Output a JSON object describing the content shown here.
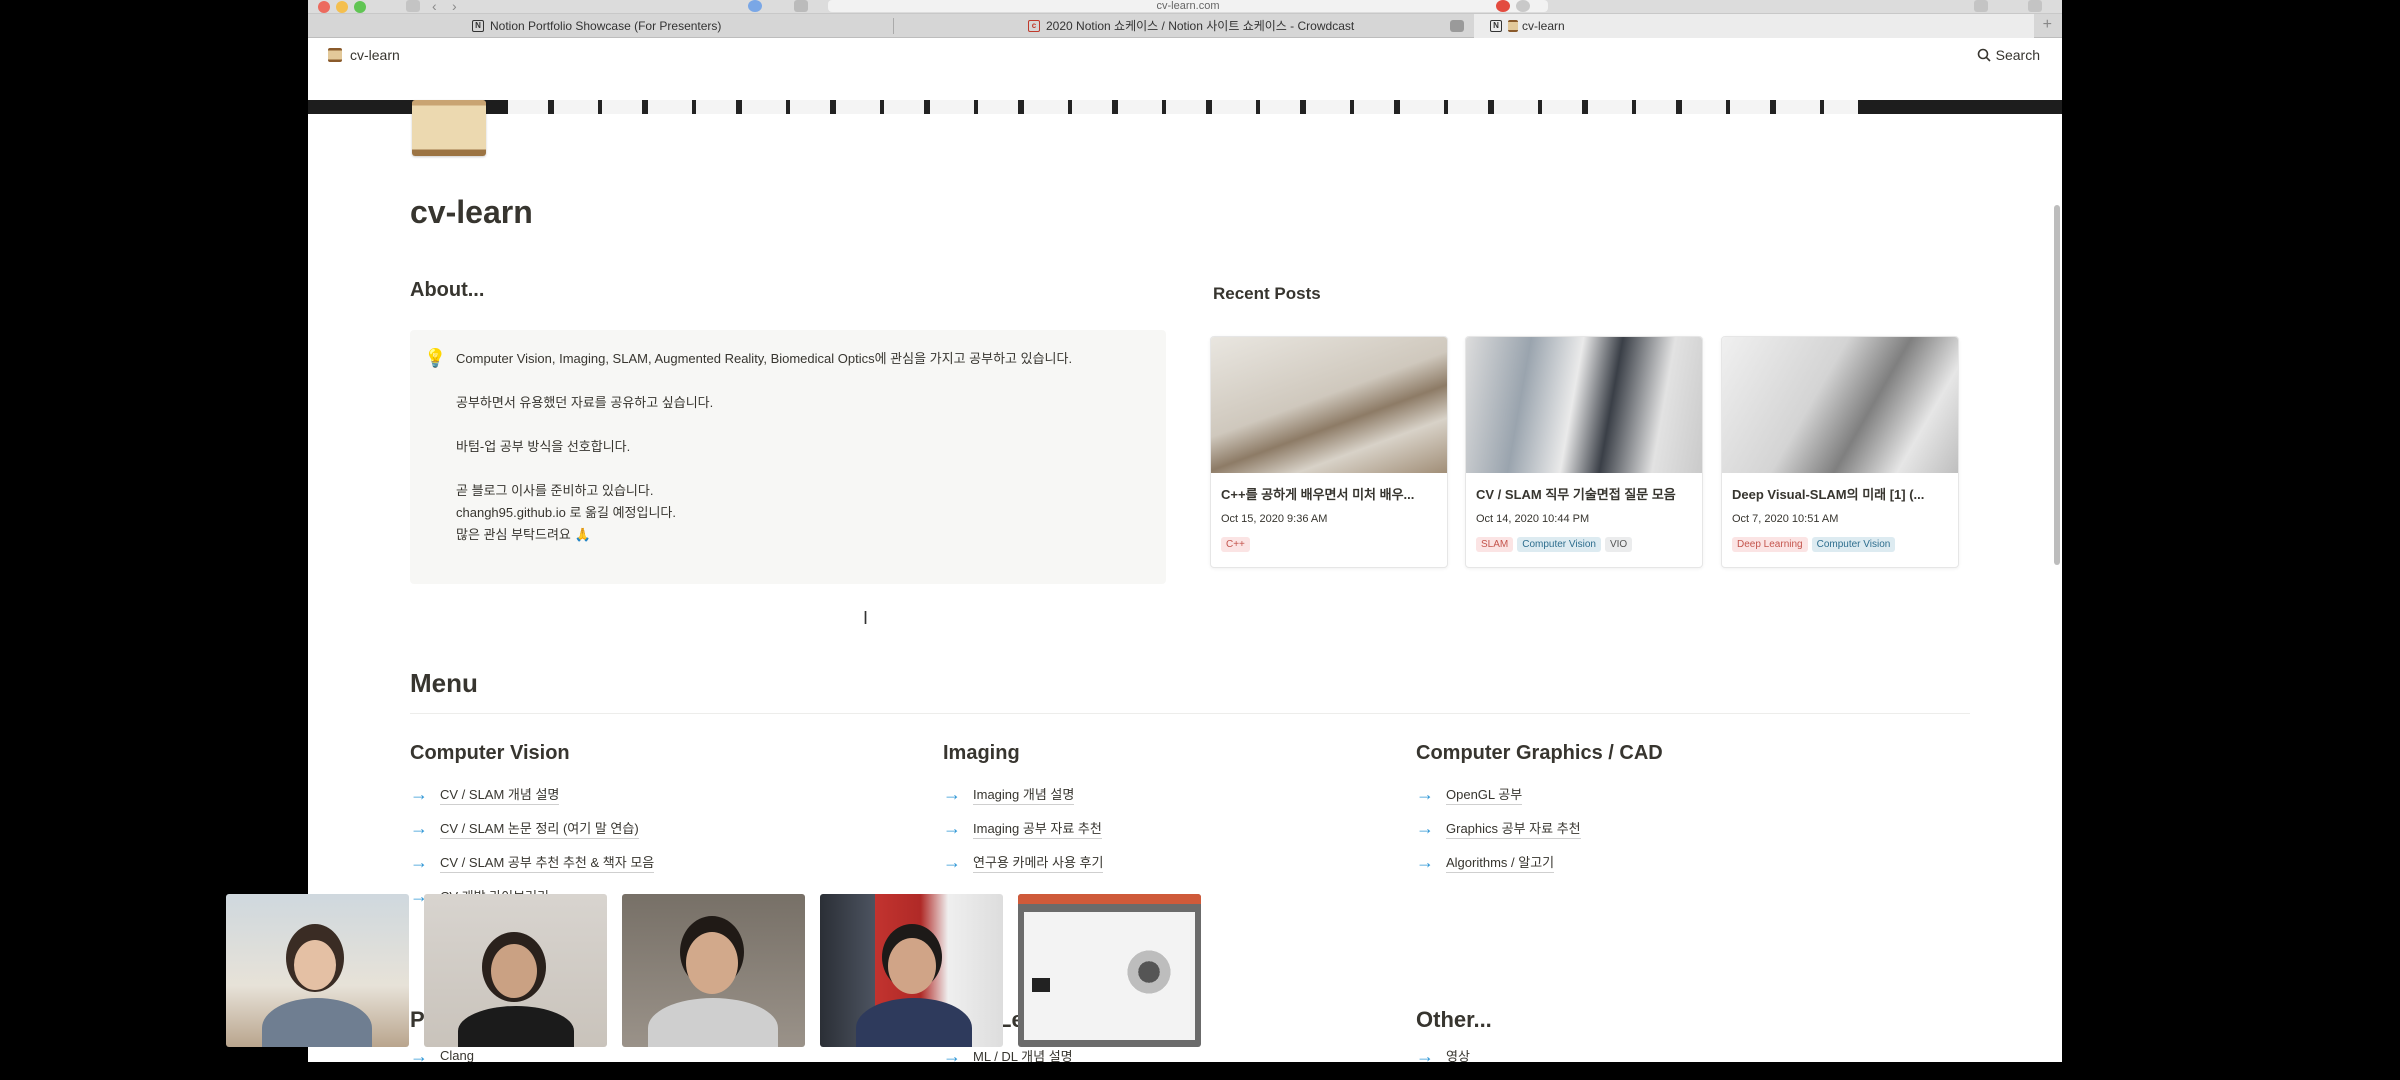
{
  "browser": {
    "url": "cv-learn.com",
    "tabs": [
      {
        "label": "Notion Portfolio Showcase (For Presenters)"
      },
      {
        "label": "2020 Notion 쇼케이스 / Notion 사이트 쇼케이스 - Crowdcast"
      },
      {
        "label": "cv-learn"
      }
    ]
  },
  "topbar": {
    "breadcrumb": "cv-learn",
    "search_label": "Search"
  },
  "page": {
    "title": "cv-learn",
    "about_heading": "About...",
    "callout_icon": "lightbulb-icon",
    "callout": {
      "line1": "Computer Vision, Imaging, SLAM, Augmented Reality, Biomedical Optics에 관심을 가지고 공부하고 있습니다.",
      "line2": "공부하면서 유용했던 자료를 공유하고 싶습니다.",
      "line3": "바텀-업 공부 방식을 선호합니다.",
      "line4": "곧 블로그 이사를 준비하고 있습니다.",
      "line5": "changh95.github.io 로 옮길 예정입니다.",
      "line6": "많은 관심 부탁드려요 🙏"
    },
    "recent_heading": "Recent Posts",
    "recent_posts": [
      {
        "title": "C++를 공하게 배우면서 미처 배우...",
        "date": "Oct 15, 2020 9:36 AM",
        "tags": [
          "C++"
        ]
      },
      {
        "title": "CV / SLAM 직무 기술면접 질문 모음",
        "date": "Oct 14, 2020 10:44 PM",
        "tags": [
          "SLAM",
          "Computer Vision",
          "VIO"
        ]
      },
      {
        "title": "Deep Visual-SLAM의 미래 [1] (...",
        "date": "Oct 7, 2020 10:51 AM",
        "tags": [
          "Deep Learning",
          "Computer Vision"
        ]
      }
    ],
    "menu_heading": "Menu",
    "columns": [
      {
        "title": "Computer Vision",
        "links": [
          "CV / SLAM 개념 설명",
          "CV / SLAM 논문 정리 (여기 말 연습)",
          "CV / SLAM 공부 추천 추천 & 책자 모음",
          "CV 개발 라이브러리"
        ]
      },
      {
        "title": "Imaging",
        "links": [
          "Imaging 개념 설명",
          "Imaging 공부 자료 추천",
          "연구용 카메라 사용 후기"
        ]
      },
      {
        "title": "Computer Graphics / CAD",
        "links": [
          "OpenGL 공부",
          "Graphics 공부 자료 추천",
          "Algorithms / 알고기"
        ]
      }
    ],
    "bottom": [
      {
        "heading": "P",
        "link": "Clang"
      },
      {
        "heading": "Learning",
        "link": "ML / DL 개념 설명"
      },
      {
        "heading": "Other...",
        "link": "영상"
      }
    ]
  },
  "colors": {
    "link_arrow": "#2f97d6",
    "tag_red": "#fbe4e4",
    "tag_blue": "#ddebf1"
  }
}
